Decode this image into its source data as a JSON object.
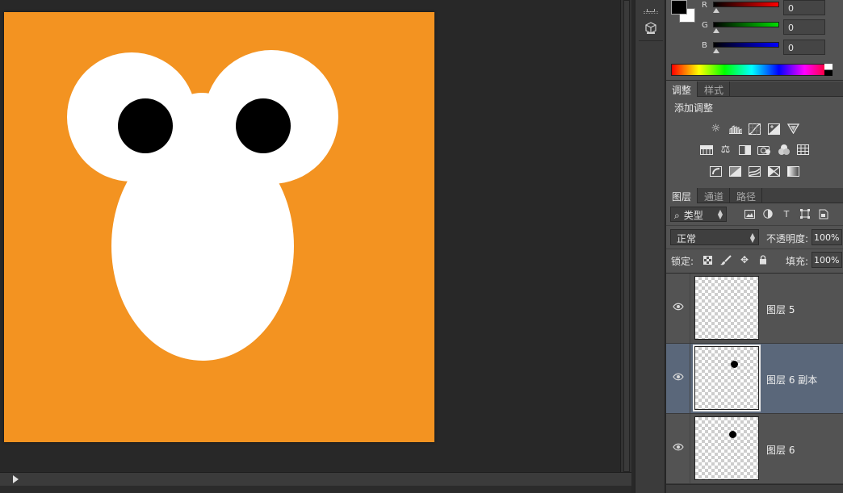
{
  "canvas": {
    "background_color": "#f39321",
    "shape_color": "#ffffff",
    "pupil_color": "#000000"
  },
  "color_panel": {
    "foreground": "#000000",
    "background": "#ffffff",
    "channels": [
      {
        "label": "R",
        "value": "0",
        "color": "#ff0000"
      },
      {
        "label": "G",
        "value": "0",
        "color": "#00cc00"
      },
      {
        "label": "B",
        "value": "0",
        "color": "#0000ff"
      }
    ]
  },
  "adjust_tabs": [
    {
      "label": "调整",
      "active": true
    },
    {
      "label": "样式",
      "active": false
    }
  ],
  "adjustments": {
    "title": "添加调整",
    "row1": [
      "brightness-icon",
      "levels-icon",
      "curves-icon",
      "exposure-icon",
      "vibrance-icon"
    ],
    "row2": [
      "hue-saturation-icon",
      "color-balance-icon",
      "black-white-icon",
      "photo-filter-icon",
      "channel-mixer-icon",
      "color-lookup-icon"
    ],
    "row3": [
      "invert-icon",
      "posterize-icon",
      "threshold-icon",
      "selective-color-icon",
      "gradient-map-icon"
    ]
  },
  "layer_tabs": [
    {
      "label": "图层",
      "active": true
    },
    {
      "label": "通道",
      "active": false
    },
    {
      "label": "路径",
      "active": false
    }
  ],
  "layers_panel": {
    "filter_label": "类型",
    "blend_mode": "正常",
    "opacity_label": "不透明度:",
    "opacity_value": "100%",
    "lock_label": "锁定:",
    "fill_label": "填充:",
    "fill_value": "100%",
    "layers": [
      {
        "name": "图层 5",
        "selected": false,
        "has_dot": false
      },
      {
        "name": "图层 6 副本",
        "selected": true,
        "has_dot": true
      },
      {
        "name": "图层 6",
        "selected": false,
        "has_dot": true
      }
    ]
  },
  "mini_toolbar": [
    "grip-icon",
    "3d-cube-icon"
  ]
}
